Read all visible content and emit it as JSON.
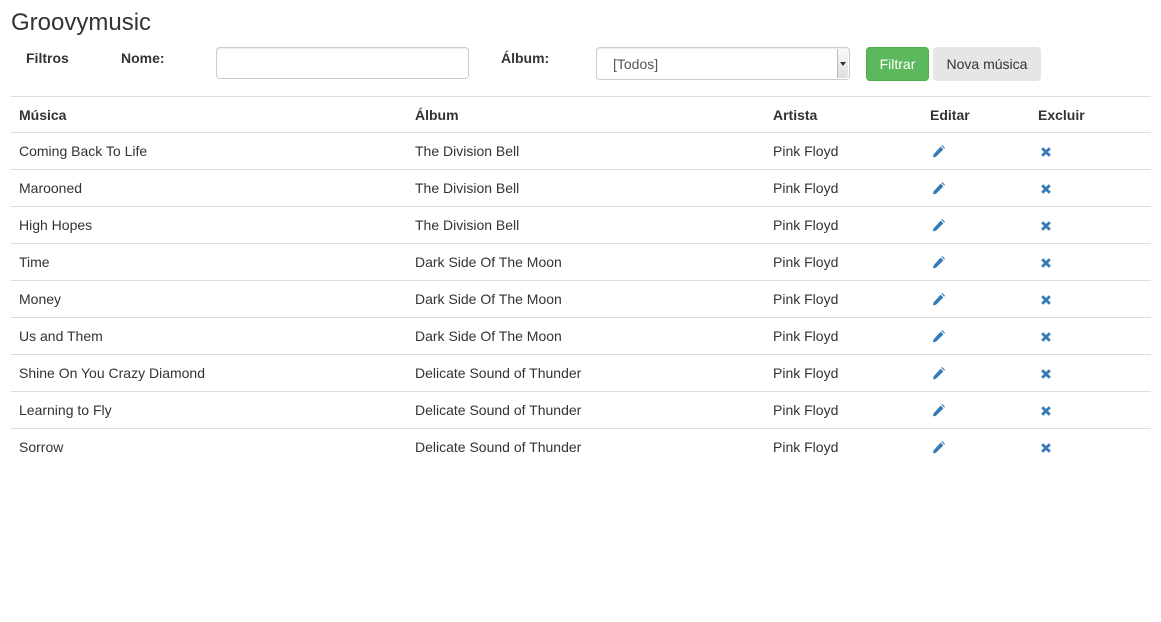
{
  "app": {
    "title": "Groovymusic"
  },
  "filters": {
    "section_label": "Filtros",
    "name_label": "Nome:",
    "name_value": "",
    "name_placeholder": "",
    "album_label": "Álbum:",
    "album_selected": "[Todos]",
    "filter_button": "Filtrar",
    "new_button": "Nova música"
  },
  "colors": {
    "filter_button_bg": "#5cb85c",
    "new_button_bg": "#e6e6e6",
    "icon_color": "#337ab7"
  },
  "table": {
    "headers": [
      "Música",
      "Álbum",
      "Artista",
      "Editar",
      "Excluir"
    ],
    "rows": [
      {
        "musica": "Coming Back To Life",
        "album": "The Division Bell",
        "artista": "Pink Floyd"
      },
      {
        "musica": "Marooned",
        "album": "The Division Bell",
        "artista": "Pink Floyd"
      },
      {
        "musica": "High Hopes",
        "album": "The Division Bell",
        "artista": "Pink Floyd"
      },
      {
        "musica": "Time",
        "album": "Dark Side Of The Moon",
        "artista": "Pink Floyd"
      },
      {
        "musica": "Money",
        "album": "Dark Side Of The Moon",
        "artista": "Pink Floyd"
      },
      {
        "musica": "Us and Them",
        "album": "Dark Side Of The Moon",
        "artista": "Pink Floyd"
      },
      {
        "musica": "Shine On You Crazy Diamond",
        "album": "Delicate Sound of Thunder",
        "artista": "Pink Floyd"
      },
      {
        "musica": "Learning to Fly",
        "album": "Delicate Sound of Thunder",
        "artista": "Pink Floyd"
      },
      {
        "musica": "Sorrow",
        "album": "Delicate Sound of Thunder",
        "artista": "Pink Floyd"
      }
    ],
    "edit_icon": "pencil-icon",
    "delete_icon": "remove-icon"
  }
}
